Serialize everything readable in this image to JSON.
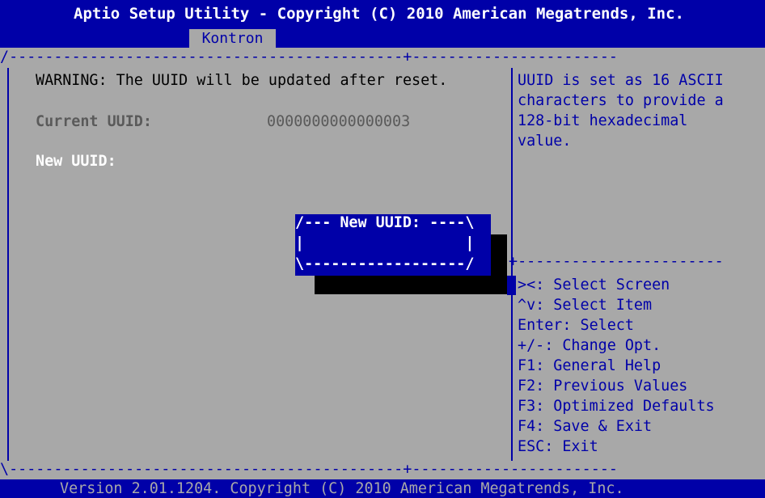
{
  "header": {
    "title": "Aptio Setup Utility - Copyright (C) 2010 American Megatrends, Inc.",
    "active_tab": "Kontron"
  },
  "frame": {
    "top_left": "/--------------------------------------------+-----------------------",
    "bottom_left": "\\--------------------------------------------+-----------------------",
    "right_separator": "+-----------------------"
  },
  "main": {
    "warning": "WARNING: The UUID will be updated after reset.",
    "current_uuid_label": "Current UUID:",
    "current_uuid_value": "0000000000000003",
    "new_uuid_label": "New UUID:"
  },
  "popup": {
    "top": "/--- New UUID: ----\\",
    "middle": "|                  |",
    "bottom": "\\------------------/",
    "value": ""
  },
  "help": {
    "lines": [
      "UUID is set as 16 ASCII",
      "characters to provide a",
      "128-bit hexadecimal",
      "value."
    ]
  },
  "keys": [
    "><: Select Screen",
    "^v: Select Item",
    "Enter: Select",
    "+/-: Change Opt.",
    "F1: General Help",
    "F2: Previous Values",
    "F3: Optimized Defaults",
    "F4: Save & Exit",
    "ESC: Exit"
  ],
  "footer": {
    "text": "Version 2.01.1204. Copyright (C) 2010 American Megatrends, Inc."
  },
  "colors": {
    "background": "#a8a8a8",
    "accent": "#0000a8",
    "highlight_text": "#ffffff"
  }
}
